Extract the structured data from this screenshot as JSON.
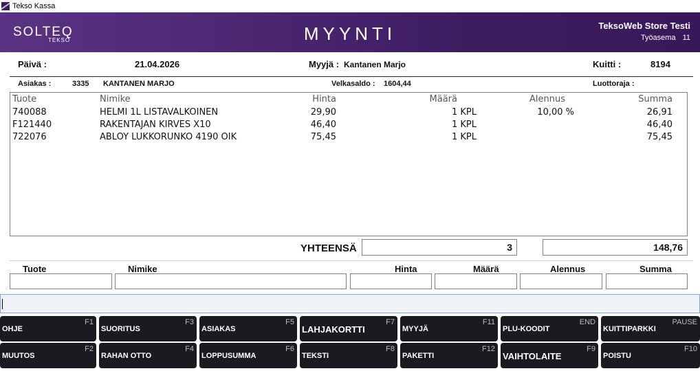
{
  "window": {
    "title": "Tekso Kassa"
  },
  "header": {
    "logo": "SOLTEQ",
    "logo_sub": "TEKSO",
    "screen_title": "MYYNTI",
    "store": "TeksoWeb Store Testi",
    "workstation_label": "Työasema",
    "workstation_number": "11"
  },
  "info": {
    "date_label": "Päivä :",
    "date": "21.04.2026",
    "seller_label": "Myyjä :",
    "seller": "Kantanen Marjo",
    "receipt_label": "Kuitti :",
    "receipt": "8194"
  },
  "customer": {
    "label": "Asiakas :",
    "number": "3335",
    "name": "KANTANEN MARJO",
    "balance_label": "Velkasaldo :",
    "balance": "1604,44",
    "credit_label": "Luottoraja :",
    "credit": ""
  },
  "grid": {
    "columns": [
      "Tuote",
      "Nimike",
      "Hinta",
      "Määrä",
      "Alennus",
      "Summa"
    ],
    "rows": [
      {
        "code": "740088",
        "name": "HELMI 1L LISTAVALKOINEN",
        "price": "29,90",
        "qty": "1 KPL",
        "discount": "10,00 %",
        "sum": "26,91"
      },
      {
        "code": "F121440",
        "name": "RAKENTAJAN KIRVES X10",
        "price": "46,40",
        "qty": "1 KPL",
        "discount": "",
        "sum": "46,40"
      },
      {
        "code": "722076",
        "name": "ABLOY LUKKORUNKO 4190 OIK",
        "price": "75,45",
        "qty": "1 KPL",
        "discount": "",
        "sum": "75,45"
      }
    ]
  },
  "totals": {
    "label": "YHTEENSÄ",
    "quantity": "3",
    "amount": "148,76"
  },
  "entry": {
    "labels": [
      "Tuote",
      "Nimike",
      "Hinta",
      "Määrä",
      "Alennus",
      "Summa"
    ]
  },
  "function_keys": [
    {
      "label": "OHJE",
      "key": "F1"
    },
    {
      "label": "SUORITUS",
      "key": "F3"
    },
    {
      "label": "ASIAKAS",
      "key": "F5"
    },
    {
      "label": "LAHJAKORTTI",
      "key": "F7"
    },
    {
      "label": "MYYJÄ",
      "key": "F11"
    },
    {
      "label": "PLU-KOODIT",
      "key": "END"
    },
    {
      "label": "KUITTIPARKKI",
      "key": "PAUSE"
    },
    {
      "label": "MUUTOS",
      "key": "F2"
    },
    {
      "label": "RAHAN OTTO",
      "key": "F4"
    },
    {
      "label": "LOPPUSUMMA",
      "key": "F6"
    },
    {
      "label": "TEKSTI",
      "key": "F8"
    },
    {
      "label": "PAKETTI",
      "key": "F12"
    },
    {
      "label": "VAIHTOLAITE",
      "key": "F9"
    },
    {
      "label": "POISTU",
      "key": "F10"
    }
  ]
}
